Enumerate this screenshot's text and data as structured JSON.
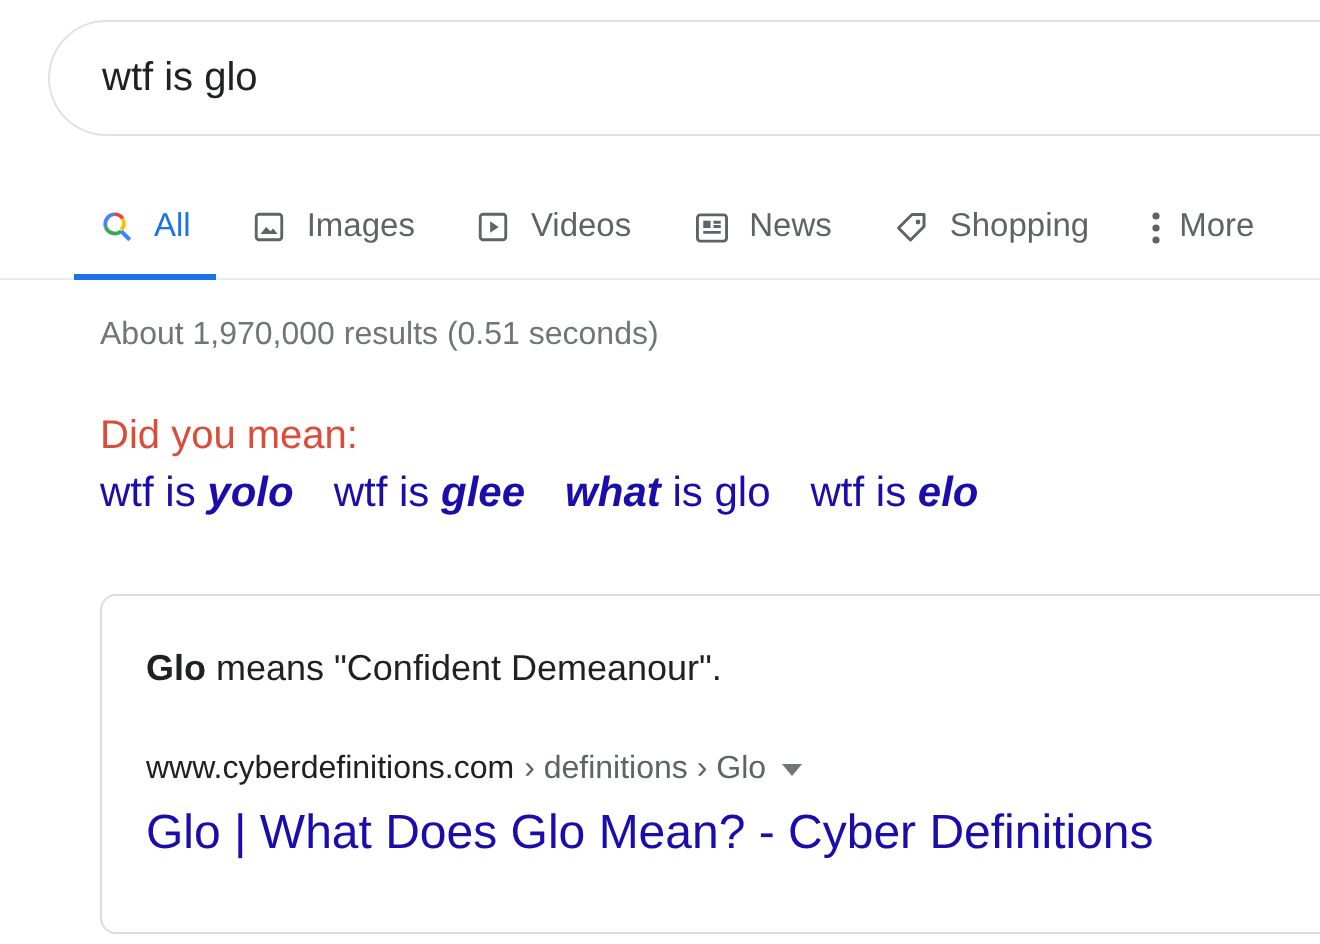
{
  "search": {
    "value": "wtf is glo"
  },
  "tabs": [
    {
      "label": "All",
      "kind": "all",
      "selected": true
    },
    {
      "label": "Images",
      "kind": "images",
      "selected": false
    },
    {
      "label": "Videos",
      "kind": "videos",
      "selected": false
    },
    {
      "label": "News",
      "kind": "news",
      "selected": false
    },
    {
      "label": "Shopping",
      "kind": "shopping",
      "selected": false
    },
    {
      "label": "More",
      "kind": "more",
      "selected": false
    }
  ],
  "result_stats": "About 1,970,000 results (0.51 seconds)",
  "did_you_mean": {
    "label": "Did you mean:",
    "suggestions": [
      {
        "parts": [
          {
            "text": "wtf is ",
            "corrected": false
          },
          {
            "text": "yolo",
            "corrected": true
          }
        ]
      },
      {
        "parts": [
          {
            "text": "wtf is ",
            "corrected": false
          },
          {
            "text": "glee",
            "corrected": true
          }
        ]
      },
      {
        "parts": [
          {
            "text": "what",
            "corrected": true
          },
          {
            "text": " is glo",
            "corrected": false
          }
        ]
      },
      {
        "parts": [
          {
            "text": "wtf is ",
            "corrected": false
          },
          {
            "text": "elo",
            "corrected": true
          }
        ]
      }
    ]
  },
  "result": {
    "snippet": "**Glo** means \"Confident Demeanour\".",
    "site": "www.cyberdefinitions.com",
    "path": "› definitions › Glo",
    "title": "Glo | What Does Glo Mean? - Cyber Definitions"
  }
}
